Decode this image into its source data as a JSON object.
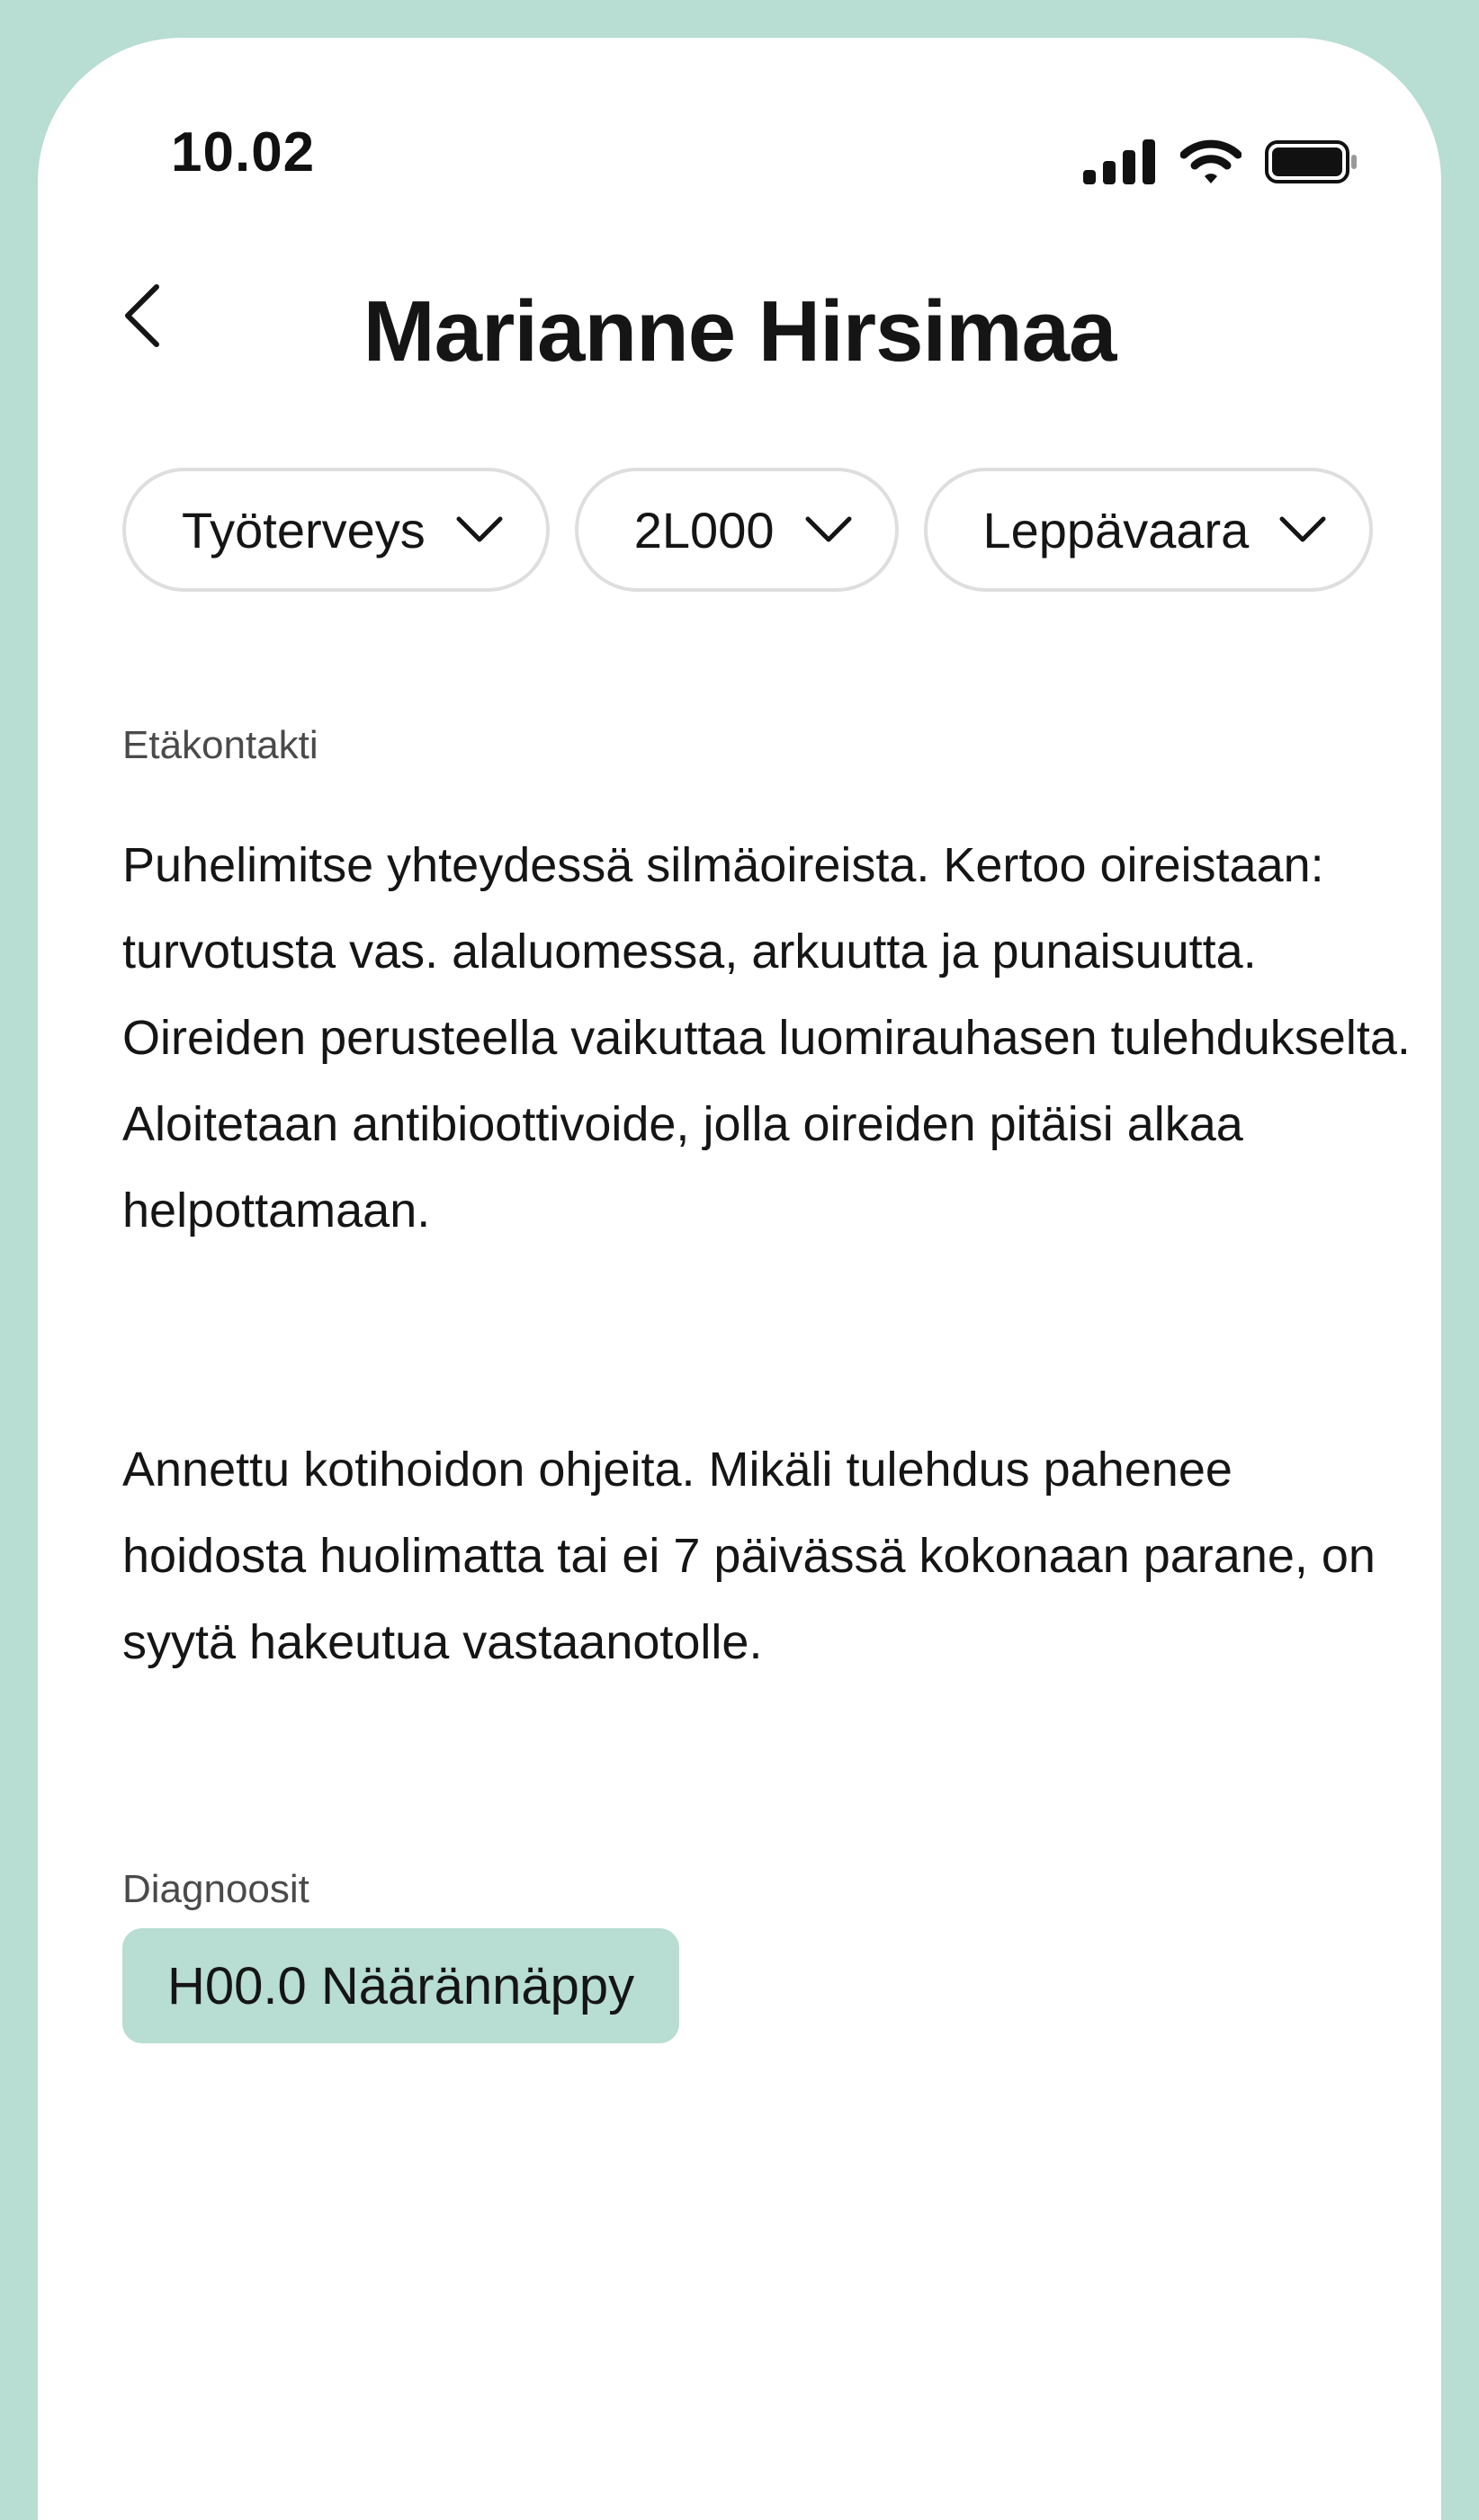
{
  "status_bar": {
    "time": "10.02",
    "icons": [
      "cellular-signal-icon",
      "wifi-icon",
      "battery-icon"
    ]
  },
  "header": {
    "back_icon": "chevron-left-icon",
    "title": "Marianne Hirsimaa"
  },
  "filters": [
    {
      "label": "Työterveys",
      "icon": "chevron-down-icon"
    },
    {
      "label": "2L000",
      "icon": "chevron-down-icon"
    },
    {
      "label": "Leppävaara",
      "icon": "chevron-down-icon"
    }
  ],
  "entry": {
    "type_label": "Etäkontakti",
    "paragraphs": [
      "Puhelimitse yhteydessä silmäoireista. Kertoo oireistaan: turvotusta vas. alaluomessa, arkuutta ja punaisuutta. Oireiden perusteella vaikuttaa luomirauhasen tulehdukselta. Aloitetaan antibioottivoide, jolla oireiden pitäisi alkaa helpottamaan.",
      "Annettu kotihoidon ohjeita. Mikäli tulehdus pahenee hoidosta huolimatta tai ei 7 päivässä kokonaan parane, on syytä hakeutua vastaanotolle."
    ]
  },
  "diagnoses": {
    "label": "Diagnoosit",
    "items": [
      "H00.0 Näärännäppy"
    ]
  },
  "colors": {
    "frame": "#b8ddd2",
    "tag_background": "#b8ddd2",
    "text": "#151515",
    "chip_border": "#dedede"
  }
}
